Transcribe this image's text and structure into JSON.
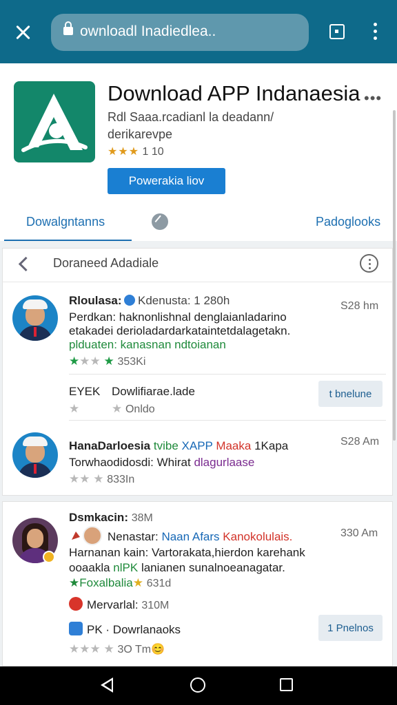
{
  "browser": {
    "url": "ownloadl Inadiedlea..",
    "icons": [
      "close-icon",
      "lock-icon",
      "tab-switcher-icon",
      "overflow-menu-icon"
    ]
  },
  "app": {
    "name": "Download APP Indanaesia",
    "subtitle_line1": "Rdl Saaa.rcadianl la deadann/",
    "subtitle_line2": "derikarevpe",
    "rating_stars": "★★★",
    "rating_text": "1 10",
    "install_button": "Powerakia liov",
    "more_icon": "•••"
  },
  "tabs": {
    "left": "Dowalgntanns",
    "middle_icon": "compose-icon",
    "right": "Padoglooks"
  },
  "feed": {
    "toolbar_title": "Doraneed Adadiale",
    "posts": [
      {
        "author": "Rloulasa:",
        "handle": "Kdenusta: 1 280h",
        "time": "S28 hm",
        "line1": "Perdkan: haknonlishnal denglaianladarino",
        "line2": "etakadei derioladardarkataintetdalagetakn.",
        "line3": "plduaten: kanasnan ndtoianan",
        "count": "353Ki",
        "sub_label": "EYEK",
        "sub_text": "Dowlifiarae.lade",
        "sub_meta": "Onldo",
        "action": "t bnelune"
      },
      {
        "author": "HanaDarloesia",
        "title_a": "tvibe",
        "title_b": "XAPP",
        "title_c": "Maaka",
        "title_d": "1Kapa",
        "time": "S28 Am",
        "line1a": "Torwhaodidosdi: Whirat",
        "line1b": "dlagurlaase",
        "count": "833In"
      },
      {
        "author": "Dsmkacin:",
        "author_meta": "38M",
        "time": "330 Am",
        "line1a": "Nenastar:",
        "line1b": "Naan Afars",
        "line1c": "Kanokolulais.",
        "line2": "Harnanan kain: Vartorakata,hierdon karehank",
        "line3a": "ooaakla",
        "line3b": "nlPK",
        "line3c": "lanianen sunalnoeanagatar.",
        "tag": "Foxalbalia",
        "tag_count": "631d",
        "mention_label": "Mervarlal:",
        "mention_meta": "310M",
        "pk_label": "PK ·",
        "pk_text": "Dowrlanaoks",
        "pk_meta": "3O Tm😊",
        "action": "1 Pnelnos"
      }
    ]
  },
  "colors": {
    "topbar": "#0e6a8a",
    "accent_blue": "#1a7fd2",
    "app_icon": "#13876a",
    "star_gold": "#e09a1c",
    "star_green": "#1e9a45"
  }
}
